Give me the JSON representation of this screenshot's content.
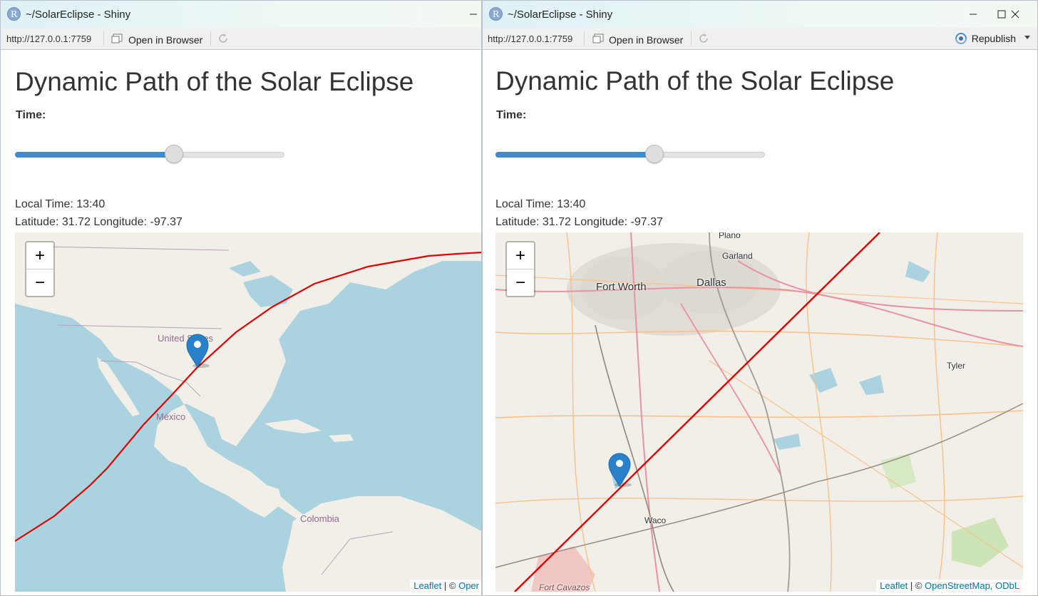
{
  "windows": [
    {
      "title": "~/SolarEclipse - Shiny",
      "url": "http://127.0.0.1:7759",
      "open_browser": "Open in Browser",
      "heading": "Dynamic Path of the Solar Eclipse",
      "time_label": "Time:",
      "slider_fraction": 0.59,
      "local_time": "Local Time: 13:40",
      "coords": "Latitude: 31.72 Longitude: -97.37",
      "map_labels": {
        "usa": "United States",
        "mexico": "México",
        "colombia": "Colombia"
      },
      "attribution": {
        "leaflet": "Leaflet",
        "sep": "| ©",
        "osm": "Oper"
      }
    },
    {
      "title": "~/SolarEclipse - Shiny",
      "url": "http://127.0.0.1:7759",
      "open_browser": "Open in Browser",
      "republish": "Republish",
      "heading": "Dynamic Path of the Solar Eclipse",
      "time_label": "Time:",
      "slider_fraction": 0.59,
      "local_time": "Local Time: 13:40",
      "coords": "Latitude: 31.72 Longitude: -97.37",
      "cities": {
        "plano": "Plano",
        "garland": "Garland",
        "fort_worth": "Fort Worth",
        "dallas": "Dallas",
        "tyler": "Tyler",
        "waco": "Waco",
        "fort_cavazos": "Fort Cavazos"
      },
      "attribution": {
        "leaflet": "Leaflet",
        "sep": "| ©",
        "osm": "OpenStreetMap, ODbL"
      }
    }
  ],
  "zoom": {
    "in": "+",
    "out": "−"
  },
  "colors": {
    "accent": "#428bca",
    "eclipse_path": "#e00000",
    "marker": "#2a81cb",
    "water": "#aad3df",
    "land": "#f2efe9"
  }
}
